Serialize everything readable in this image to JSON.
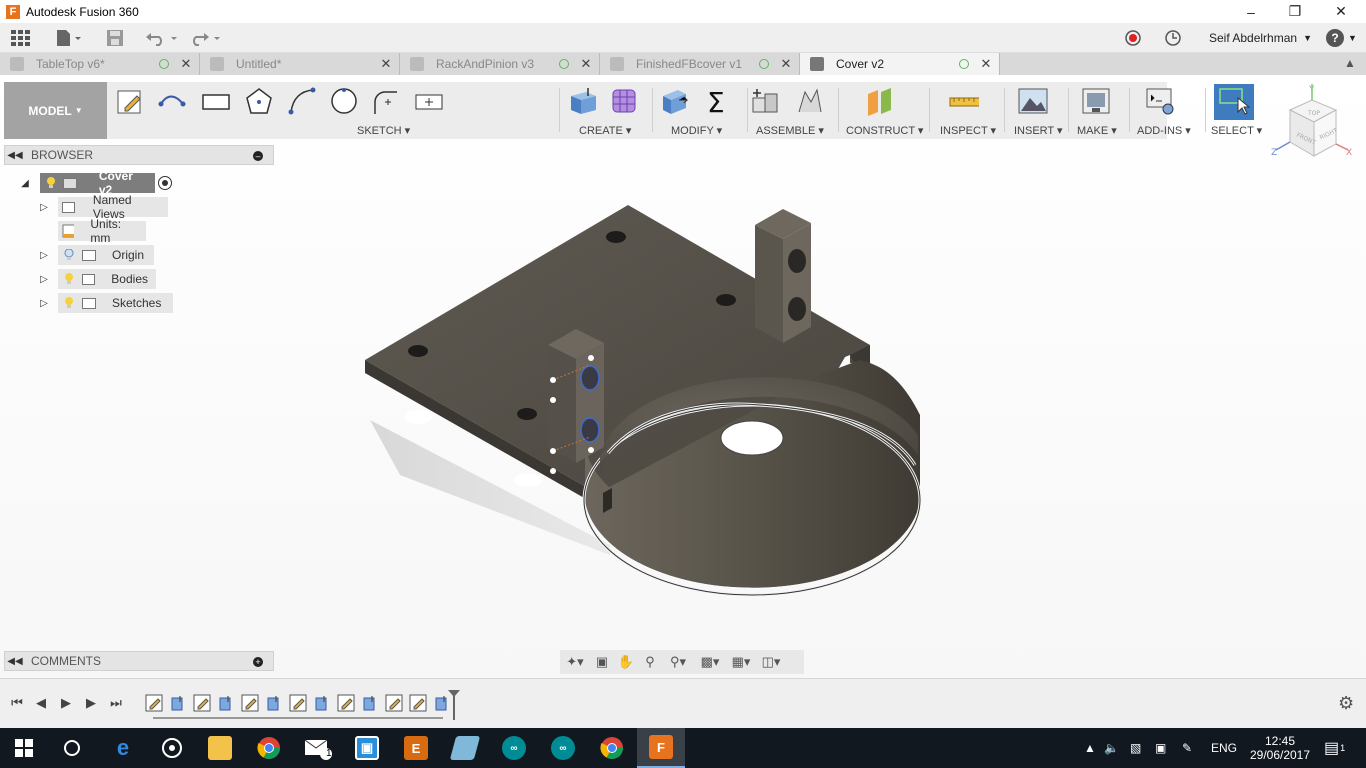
{
  "window": {
    "title": "Autodesk Fusion 360",
    "app_icon_letter": "F"
  },
  "quick_access": {
    "user_name": "Seif Abdelrhman",
    "help_label": "?"
  },
  "tabs": [
    {
      "label": "TableTop v6*",
      "active": false
    },
    {
      "label": "Untitled*",
      "active": false
    },
    {
      "label": "RackAndPinion v3",
      "active": false
    },
    {
      "label": "FinishedFBcover v1",
      "active": false
    },
    {
      "label": "Cover v2",
      "active": true
    }
  ],
  "ribbon": {
    "workspace": "MODEL",
    "groups": [
      {
        "label": "SKETCH ▾"
      },
      {
        "label": "CREATE ▾"
      },
      {
        "label": "MODIFY ▾"
      },
      {
        "label": "ASSEMBLE ▾"
      },
      {
        "label": "CONSTRUCT ▾"
      },
      {
        "label": "INSPECT ▾"
      },
      {
        "label": "INSERT ▾"
      },
      {
        "label": "MAKE ▾"
      },
      {
        "label": "ADD-INS ▾"
      },
      {
        "label": "SELECT ▾"
      }
    ]
  },
  "viewcube": {
    "top": "TOP",
    "front": "FRONT",
    "right": "RIGHT",
    "axis_x": "X",
    "axis_y": "Y",
    "axis_z": "Z"
  },
  "browser": {
    "title": "BROWSER",
    "root": "Cover v2",
    "items": [
      {
        "label": "Named Views"
      },
      {
        "label": "Units: mm"
      },
      {
        "label": "Origin"
      },
      {
        "label": "Bodies"
      },
      {
        "label": "Sketches"
      }
    ]
  },
  "comments": {
    "title": "COMMENTS"
  },
  "taskbar": {
    "language": "ENG",
    "time": "12:45",
    "date": "29/06/2017",
    "mail_badge": "1",
    "notification_badge": "1"
  },
  "colors": {
    "accent_select": "#3f7cbf",
    "brand_orange": "#e8731f",
    "model_button": "#a3a3a3",
    "taskbar": "#111820"
  }
}
